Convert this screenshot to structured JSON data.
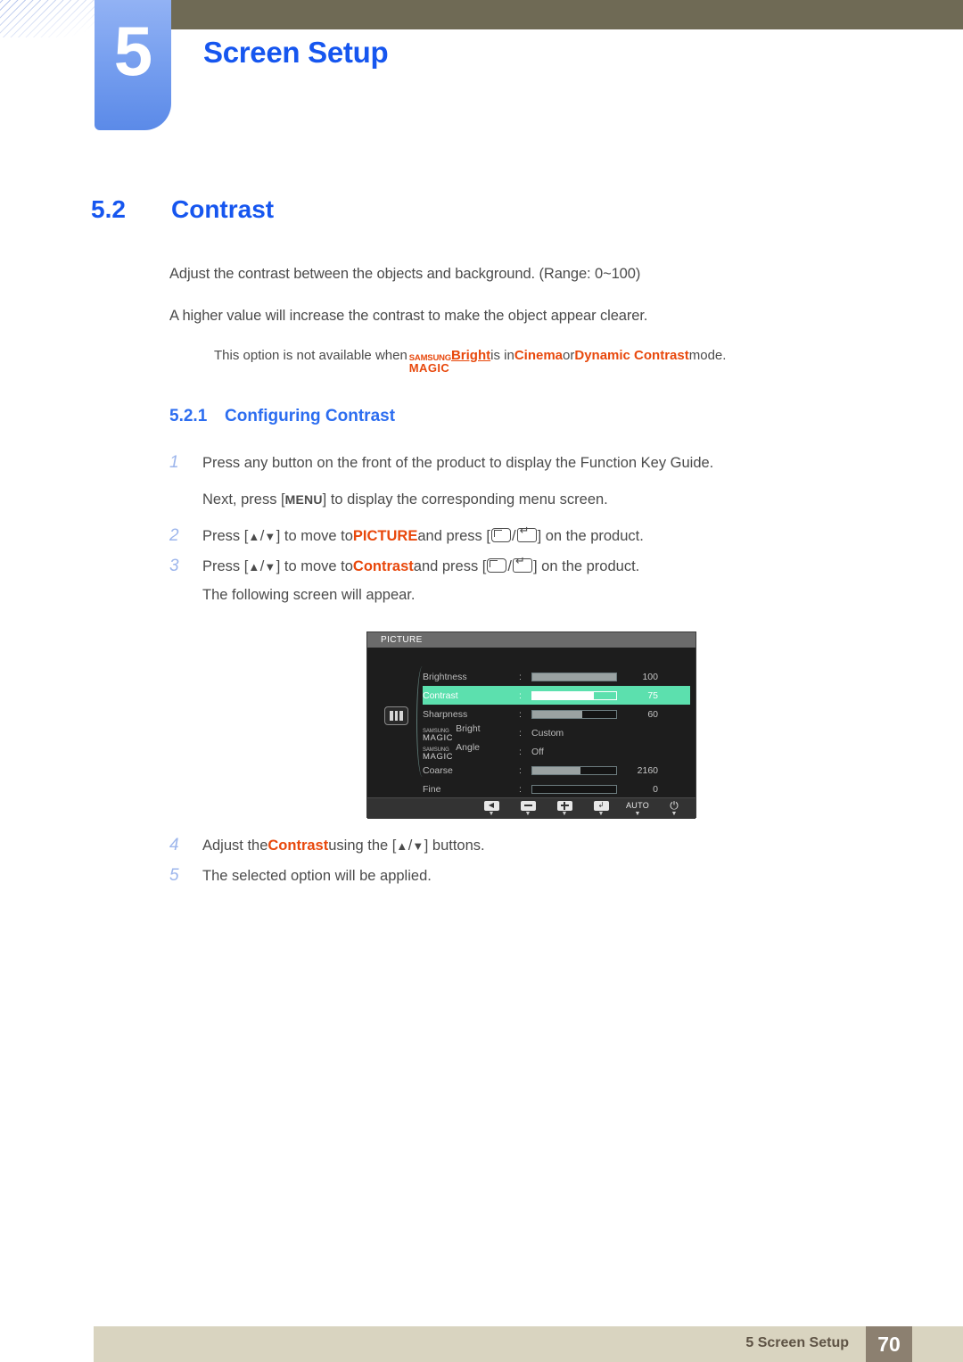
{
  "chapter": {
    "number": "5",
    "title": "Screen Setup"
  },
  "section": {
    "number": "5.2",
    "title": "Contrast"
  },
  "paragraphs": {
    "p1": "Adjust the contrast between the objects and background. (Range: 0~100)",
    "p2": "A higher value will increase the contrast to make the object appear clearer."
  },
  "note": {
    "lead": "This option is not available when ",
    "magic_top": "SAMSUNG",
    "magic_bottom": "MAGIC",
    "bright": "Bright",
    "mid": " is in ",
    "mode1": "Cinema",
    "conj": " or ",
    "mode2": "Dynamic Contrast",
    "tail": " mode."
  },
  "subsection": {
    "number": "5.2.1",
    "title": "Configuring Contrast"
  },
  "steps": {
    "s1_index": "1",
    "s1_text": "Press any button on the front of the product to display the Function Key Guide.",
    "s1b_pre": "Next, press [",
    "s1b_key": "MENU",
    "s1b_post": "] to display the corresponding menu screen.",
    "s2_index": "2",
    "s2_pre": "Press [",
    "s2_up": "▲",
    "s2_slash": "/",
    "s2_down": "▼",
    "s2_mid": "] to move to ",
    "s2_target": "PICTURE",
    "s2_mid2": " and press [",
    "s2_post": "] on the product.",
    "s3_index": "3",
    "s3_pre": "Press [",
    "s3_mid": "] to move to ",
    "s3_target": "Contrast",
    "s3_mid2": " and press [",
    "s3_post": "] on the product.",
    "s3b_text": "The following screen will appear.",
    "s4_index": "4",
    "s4_pre": "Adjust the ",
    "s4_target": "Contrast",
    "s4_mid": " using the [",
    "s4_post": "] buttons.",
    "s5_index": "5",
    "s5_text": "The selected option will be applied."
  },
  "osd": {
    "title": "PICTURE",
    "category_icon": "picture-icon",
    "rows": [
      {
        "label": "Brightness",
        "type": "bar",
        "fill": 100,
        "value": "100",
        "active": false
      },
      {
        "label": "Contrast",
        "type": "bar",
        "fill": 73,
        "value": "75",
        "active": true
      },
      {
        "label": "Sharpness",
        "type": "bar",
        "fill": 60,
        "value": "60",
        "active": false
      },
      {
        "label": "MAGIC Bright",
        "magic_top": "SAMSUNG",
        "magic_bottom": "MAGIC",
        "suffix": "Bright",
        "type": "text",
        "value": "Custom",
        "active": false
      },
      {
        "label": "MAGIC Angle",
        "magic_top": "SAMSUNG",
        "magic_bottom": "MAGIC",
        "suffix": "Angle",
        "type": "text",
        "value": "Off",
        "active": false
      },
      {
        "label": "Coarse",
        "type": "bar",
        "fill": 57,
        "value": "2160",
        "active": false
      },
      {
        "label": "Fine",
        "type": "bar",
        "fill": 0,
        "value": "0",
        "active": false
      }
    ],
    "footer_buttons": [
      {
        "icon": "back-arrow-icon",
        "glyph": "◀",
        "caret": "▼"
      },
      {
        "icon": "minus-icon",
        "glyph": "",
        "caret": "▼"
      },
      {
        "icon": "plus-icon",
        "glyph": "",
        "caret": "▼"
      },
      {
        "icon": "enter-icon",
        "glyph": "↲",
        "caret": "▼"
      },
      {
        "icon": "auto-label",
        "glyph": "AUTO",
        "caret": "▼"
      },
      {
        "icon": "power-icon",
        "glyph": "⏻",
        "caret": "▼"
      }
    ],
    "colors": {
      "highlight": "#5ce0ae",
      "title_bar": "#6b6b6b",
      "background": "#1d1d1d"
    }
  },
  "footer": {
    "label": "5 Screen Setup",
    "page": "70"
  },
  "colors": {
    "heading_blue": "#1656ef",
    "accent_orange": "#e8480c",
    "olive": "#6f6a55",
    "footer_beige": "#d9d4c0",
    "footer_page_bg": "#8c8070"
  }
}
